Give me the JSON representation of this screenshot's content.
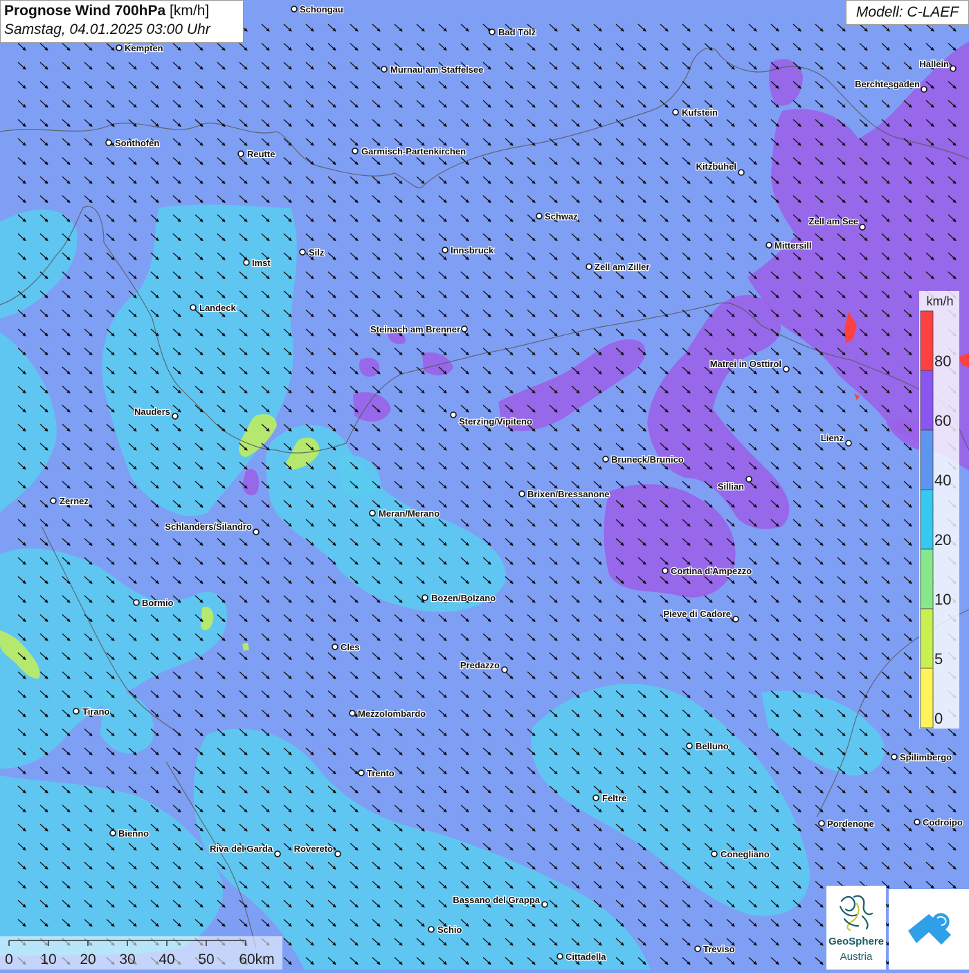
{
  "header": {
    "title_bold": "Prognose Wind 700hPa",
    "title_unit": " [km/h]",
    "subtitle": "Samstag, 04.01.2025 03:00 Uhr",
    "model": "Modell: C-LAEF"
  },
  "legend": {
    "unit": "km/h",
    "bins": [
      {
        "color": "#ff4040"
      },
      {
        "color": "#8a55f0"
      },
      {
        "color": "#5e95f0"
      },
      {
        "color": "#36c8f0"
      },
      {
        "color": "#86e88a"
      },
      {
        "color": "#c8f050"
      },
      {
        "color": "#fff35a"
      }
    ],
    "labels": [
      "80",
      "60",
      "40",
      "20",
      "10",
      "5",
      "0"
    ]
  },
  "scale": {
    "ticks": [
      "0",
      "10",
      "20",
      "30",
      "40",
      "50",
      "60km"
    ]
  },
  "logos": {
    "geosphere_line1": "GeoSphere",
    "geosphere_line2": "Austria"
  },
  "cities": [
    {
      "name": "Schongau"
    },
    {
      "name": "Bad Tölz"
    },
    {
      "name": "Kempten"
    },
    {
      "name": "Murnau am Staffelsee"
    },
    {
      "name": "Hallein"
    },
    {
      "name": "Berchtesgaden"
    },
    {
      "name": "Kufstein"
    },
    {
      "name": "Sonthofen"
    },
    {
      "name": "Reutte"
    },
    {
      "name": "Garmisch-Partenkirchen"
    },
    {
      "name": "Kitzbühel"
    },
    {
      "name": "Schwaz"
    },
    {
      "name": "Zell am See"
    },
    {
      "name": "Mittersill"
    },
    {
      "name": "Innsbruck"
    },
    {
      "name": "Silz"
    },
    {
      "name": "Imst"
    },
    {
      "name": "Zell am Ziller"
    },
    {
      "name": "Landeck"
    },
    {
      "name": "Steinach am Brenner"
    },
    {
      "name": "Matrei in Osttirol"
    },
    {
      "name": "Nauders"
    },
    {
      "name": "Sterzing/Vipiteno"
    },
    {
      "name": "Lienz"
    },
    {
      "name": "Bruneck/Brunico"
    },
    {
      "name": "Sillian"
    },
    {
      "name": "Zernez"
    },
    {
      "name": "Brixen/Bressanone"
    },
    {
      "name": "Meran/Merano"
    },
    {
      "name": "Schlanders/Silandro"
    },
    {
      "name": "Cortina d'Ampezzo"
    },
    {
      "name": "Bozen/Bolzano"
    },
    {
      "name": "Bormio"
    },
    {
      "name": "Pieve di Cadore"
    },
    {
      "name": "Cles"
    },
    {
      "name": "Predazzo"
    },
    {
      "name": "Tirano"
    },
    {
      "name": "Mezzolombardo"
    },
    {
      "name": "Belluno"
    },
    {
      "name": "Spilimbergo"
    },
    {
      "name": "Trento"
    },
    {
      "name": "Feltre"
    },
    {
      "name": "Pordenone"
    },
    {
      "name": "Codroipo"
    },
    {
      "name": "Bienno"
    },
    {
      "name": "Riva del Garda"
    },
    {
      "name": "Rovereto"
    },
    {
      "name": "Conegliano"
    },
    {
      "name": "Bassano del Grappa"
    },
    {
      "name": "Schio"
    },
    {
      "name": "Treviso"
    },
    {
      "name": "Cittadella"
    }
  ],
  "colors": {
    "wind_40_60": "#7f9ff5",
    "wind_20_40": "#59cdf0",
    "wind_60_80": "#9a62e8",
    "wind_80_plus": "#ff4040",
    "wind_5_10": "#b8ea66",
    "arrow": "#111111"
  },
  "arrow_direction": "south-east"
}
